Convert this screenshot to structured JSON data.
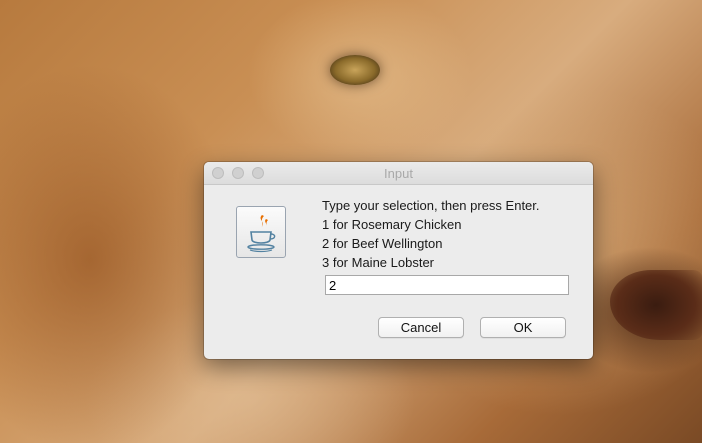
{
  "dialog": {
    "title": "Input",
    "message_lines": [
      "Type your selection, then press Enter.",
      "1 for Rosemary Chicken",
      "2 for Beef Wellington",
      "3 for Maine Lobster"
    ],
    "input_value": "2",
    "cancel_label": "Cancel",
    "ok_label": "OK",
    "icon": "java-cup-icon"
  },
  "window_controls": [
    "close-button",
    "minimize-button",
    "zoom-button"
  ],
  "colors": {
    "dialog_background": "#ececec",
    "title_text": "#a9a9a9",
    "java_orange": "#e76f00",
    "java_blue": "#5382a1"
  }
}
